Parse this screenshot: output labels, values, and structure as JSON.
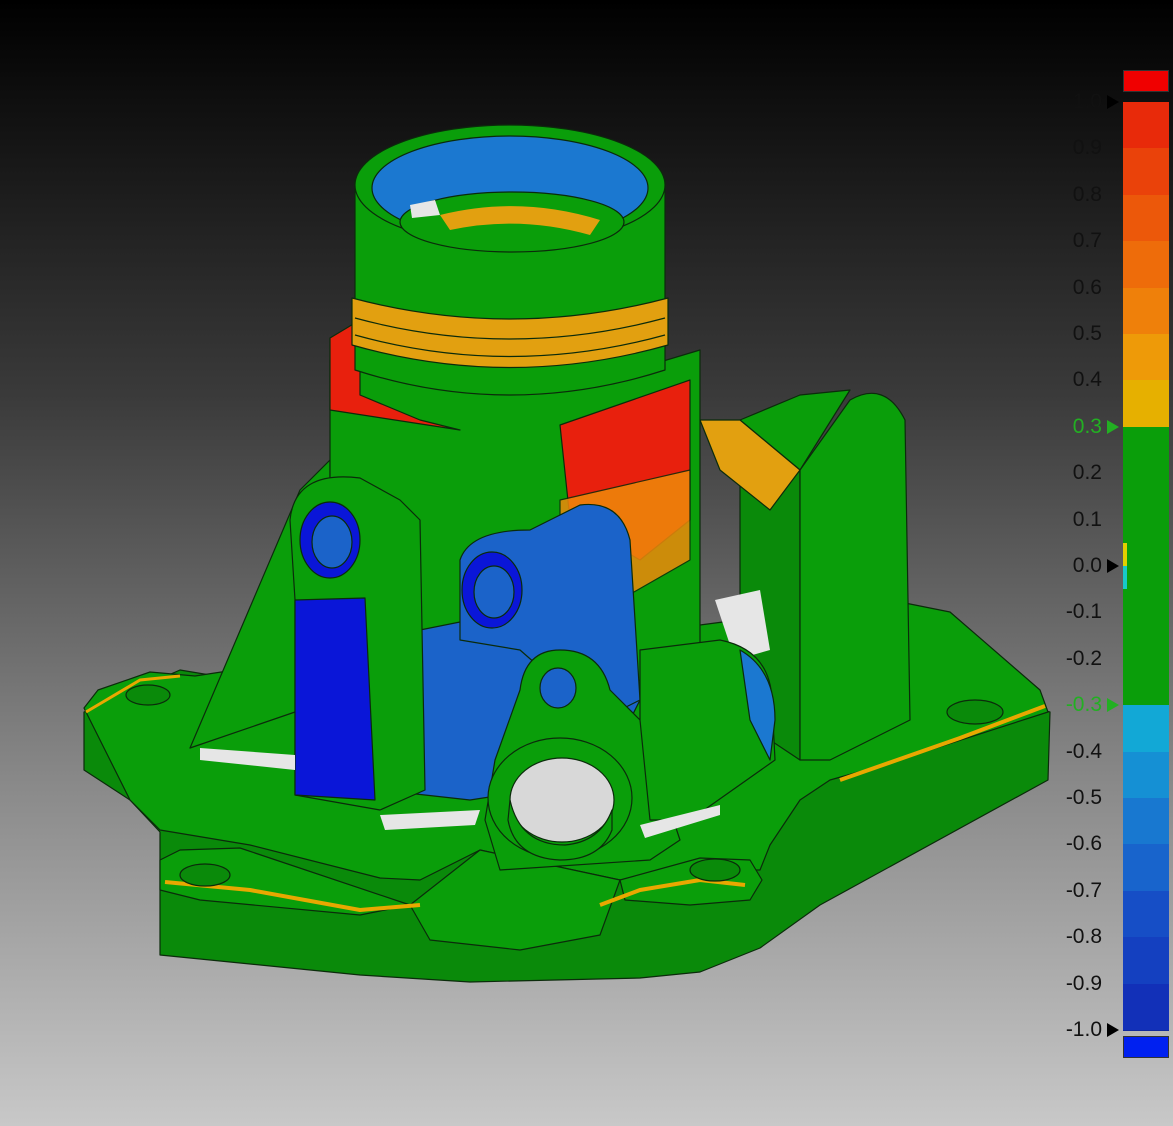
{
  "viewport": {
    "part": "deviation-colormap-casting",
    "colors": {
      "nominal_green": "#0a9e0a",
      "positive_high_red": "#e8150d",
      "positive_mid_orange": "#ef8a0a",
      "positive_low_yellow": "#e2b800",
      "negative_low_cyan": "#12a8d6",
      "negative_mid_blue": "#1b63c9",
      "negative_high_blue": "#0a16d8",
      "no_data_white": "#e6e6e6",
      "edge_lines": "#0b2b0b"
    }
  },
  "color_scale": {
    "over_color": "#f00000",
    "under_color": "#0020f0",
    "upper_tolerance_color": "#22b022",
    "lower_tolerance_color": "#22b022",
    "ticks": [
      {
        "label": "1.0",
        "value": 1.0,
        "tolerance": false
      },
      {
        "label": "0.9",
        "value": 0.9,
        "tolerance": false
      },
      {
        "label": "0.8",
        "value": 0.8,
        "tolerance": false
      },
      {
        "label": "0.7",
        "value": 0.7,
        "tolerance": false
      },
      {
        "label": "0.6",
        "value": 0.6,
        "tolerance": false
      },
      {
        "label": "0.5",
        "value": 0.5,
        "tolerance": false
      },
      {
        "label": "0.4",
        "value": 0.4,
        "tolerance": false
      },
      {
        "label": "0.3",
        "value": 0.3,
        "tolerance": true
      },
      {
        "label": "0.2",
        "value": 0.2,
        "tolerance": false
      },
      {
        "label": "0.1",
        "value": 0.1,
        "tolerance": false
      },
      {
        "label": "0.0",
        "value": 0.0,
        "tolerance": false
      },
      {
        "label": "-0.1",
        "value": -0.1,
        "tolerance": false
      },
      {
        "label": "-0.2",
        "value": -0.2,
        "tolerance": false
      },
      {
        "label": "-0.3",
        "value": -0.3,
        "tolerance": true
      },
      {
        "label": "-0.4",
        "value": -0.4,
        "tolerance": false
      },
      {
        "label": "-0.5",
        "value": -0.5,
        "tolerance": false
      },
      {
        "label": "-0.6",
        "value": -0.6,
        "tolerance": false
      },
      {
        "label": "-0.7",
        "value": -0.7,
        "tolerance": false
      },
      {
        "label": "-0.8",
        "value": -0.8,
        "tolerance": false
      },
      {
        "label": "-0.9",
        "value": -0.9,
        "tolerance": false
      },
      {
        "label": "-1.0",
        "value": -1.0,
        "tolerance": false
      }
    ],
    "bands": [
      {
        "from": 0.9,
        "to": 1.0,
        "color": "#e82a0a"
      },
      {
        "from": 0.8,
        "to": 0.9,
        "color": "#ea420a"
      },
      {
        "from": 0.7,
        "to": 0.8,
        "color": "#ec580a"
      },
      {
        "from": 0.6,
        "to": 0.7,
        "color": "#ee6c0a"
      },
      {
        "from": 0.5,
        "to": 0.6,
        "color": "#ef800a"
      },
      {
        "from": 0.4,
        "to": 0.5,
        "color": "#ee9a08"
      },
      {
        "from": 0.3,
        "to": 0.4,
        "color": "#e6b000"
      },
      {
        "from": 0.0,
        "to": 0.3,
        "color": "#0a9e0a"
      },
      {
        "from": -0.3,
        "to": 0.0,
        "color": "#0a9e0a"
      },
      {
        "from": -0.4,
        "to": -0.3,
        "color": "#12a8d6"
      },
      {
        "from": -0.5,
        "to": -0.4,
        "color": "#1590d4"
      },
      {
        "from": -0.6,
        "to": -0.5,
        "color": "#1878d0"
      },
      {
        "from": -0.7,
        "to": -0.6,
        "color": "#1864cc"
      },
      {
        "from": -0.8,
        "to": -0.7,
        "color": "#164ec6"
      },
      {
        "from": -0.9,
        "to": -0.8,
        "color": "#1440c0"
      },
      {
        "from": -1.0,
        "to": -0.9,
        "color": "#1230b8"
      }
    ],
    "zero_marker_colors": {
      "above": "#e2d000",
      "below": "#18c8c8"
    }
  }
}
